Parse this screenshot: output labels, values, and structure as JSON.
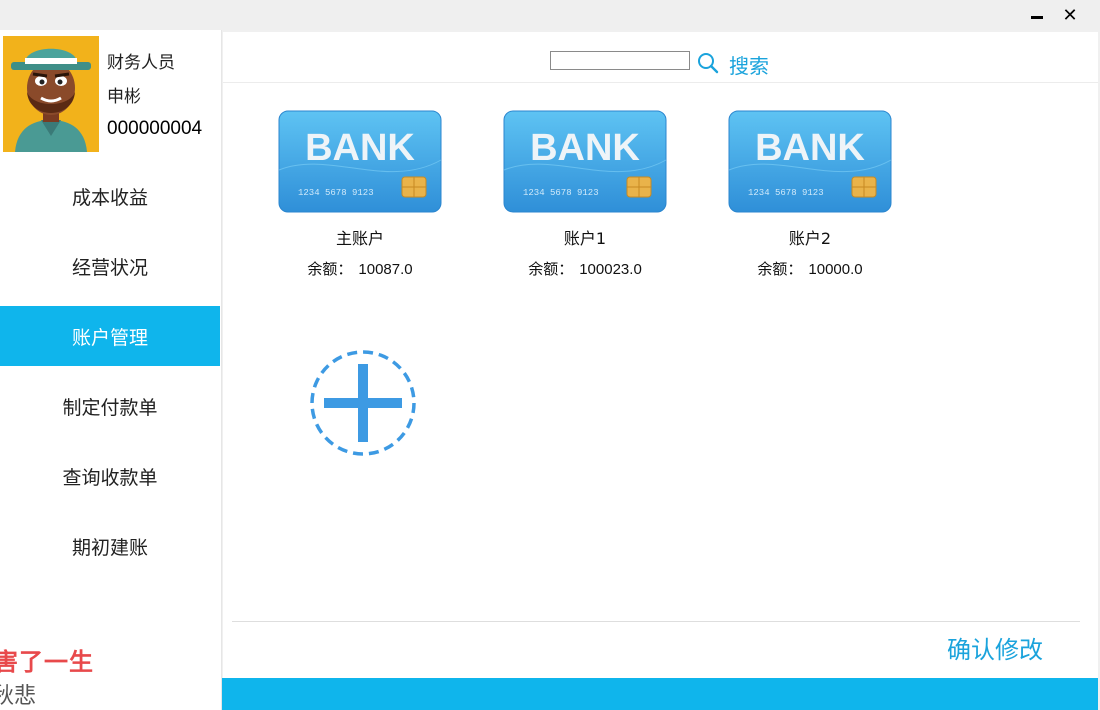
{
  "window": {
    "minimize_icon": "minimize-icon",
    "close_icon": "close-icon",
    "close_glyph": "✕"
  },
  "user": {
    "role": "财务人员",
    "name": "申彬",
    "id": "000000004"
  },
  "menu": [
    {
      "label": "成本收益",
      "active": false
    },
    {
      "label": "经营状况",
      "active": false
    },
    {
      "label": "账户管理",
      "active": true
    },
    {
      "label": "制定付款单",
      "active": false
    },
    {
      "label": "查询收款单",
      "active": false
    },
    {
      "label": "期初建账",
      "active": false
    }
  ],
  "marquee": {
    "line1": "害了一生",
    "line2": "秋悲"
  },
  "search": {
    "value": "",
    "placeholder": "",
    "label": "搜索"
  },
  "cards": [
    {
      "name": "主账户",
      "balance_label": "余额：",
      "balance": "10087.0",
      "card_text": "BANK",
      "card_number": "1234 5678 9123"
    },
    {
      "name": "账户1",
      "balance_label": "余额：",
      "balance": "100023.0",
      "card_text": "BANK",
      "card_number": "1234 5678 9123"
    },
    {
      "name": "账户2",
      "balance_label": "余额：",
      "balance": "10000.0",
      "card_text": "BANK",
      "card_number": "1234 5678 9123"
    }
  ],
  "confirm_label": "确认修改",
  "colors": {
    "accent": "#0fb5ec",
    "link": "#1aa3dc",
    "card_blue": "#3b9ee0",
    "add_blue": "#3d9ae3"
  }
}
